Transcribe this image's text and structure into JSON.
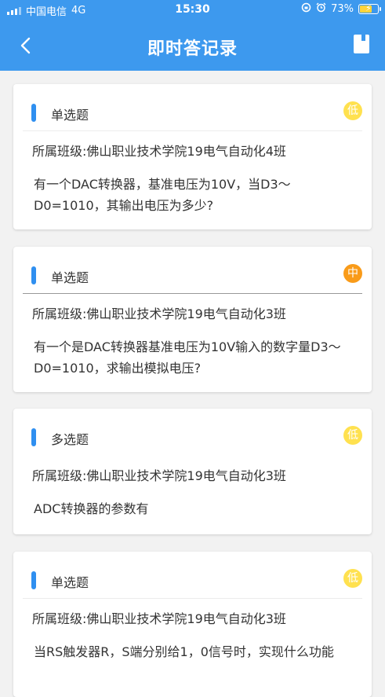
{
  "status_bar": {
    "carrier": "中国电信",
    "network": "4G",
    "time": "15:30",
    "battery": "73%",
    "battery_level": 0.73
  },
  "nav": {
    "title": "即时答记录",
    "back_icon": "chevron-left-icon",
    "right_icon": "book-icon"
  },
  "colors": {
    "primary": "#3d99ee",
    "accent_bar": "#2f8ff0",
    "level_low": "#ffe14f",
    "level_mid": "#f99b19"
  },
  "records": [
    {
      "type": "单选题",
      "level": "低",
      "class": "所属班级:佛山职业技术学院19电气自动化4班",
      "question": "有一个DAC转换器，基准电压为10V，当D3～D0=1010，其输出电压为多少?"
    },
    {
      "type": "单选题",
      "level": "中",
      "class": "所属班级:佛山职业技术学院19电气自动化3班",
      "question": "有一个是DAC转换器基准电压为10V输入的数字量D3～D0=1010，求输出模拟电压?"
    },
    {
      "type": "多选题",
      "level": "低",
      "class": "所属班级:佛山职业技术学院19电气自动化3班",
      "question": "ADC转换器的参数有"
    },
    {
      "type": "单选题",
      "level": "低",
      "class": "所属班级:佛山职业技术学院19电气自动化3班",
      "question": "当RS触发器R，S端分别给1，0信号时，实现什么功能"
    }
  ]
}
